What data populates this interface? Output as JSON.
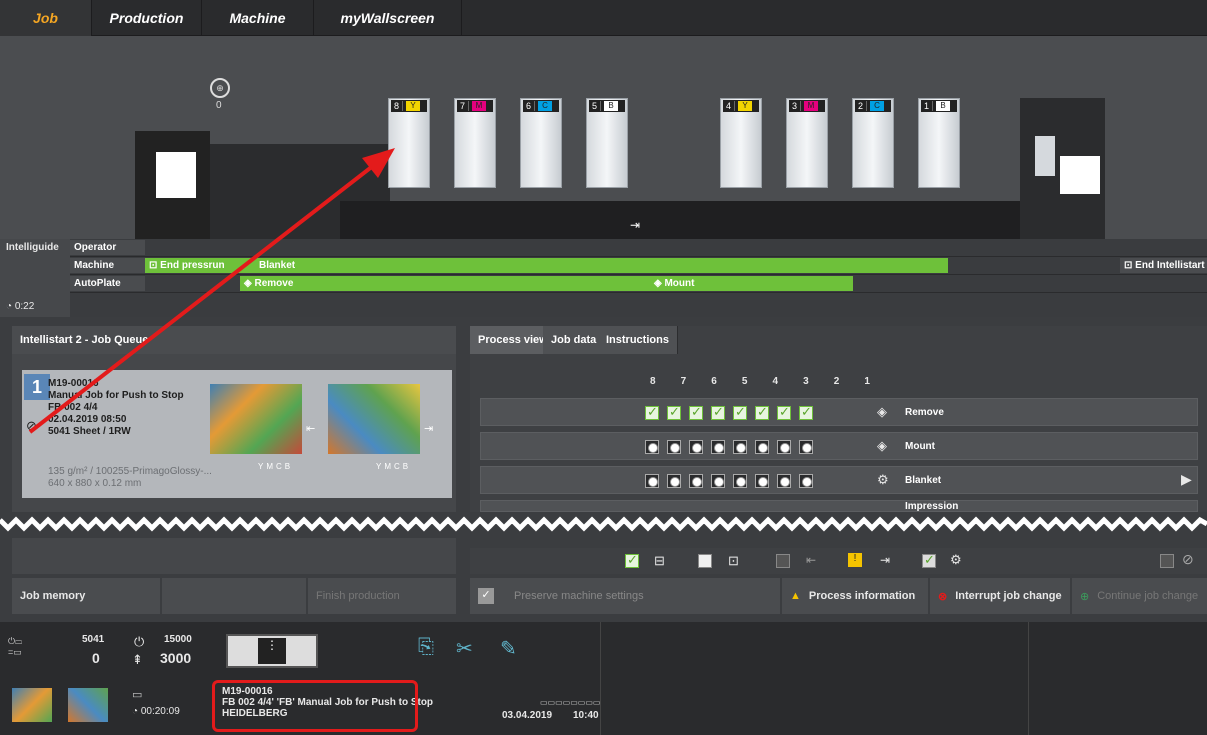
{
  "nav": {
    "tabs": [
      "Job",
      "Production",
      "Machine",
      "myWallscreen"
    ],
    "active": "Job"
  },
  "machine": {
    "counter_value": "0",
    "units": [
      {
        "num": "8",
        "color": "Y",
        "hex": "#f2d400"
      },
      {
        "num": "7",
        "color": "M",
        "hex": "#e5007e"
      },
      {
        "num": "6",
        "color": "C",
        "hex": "#00a0e3"
      },
      {
        "num": "5",
        "color": "B",
        "hex": "#ffffff"
      },
      {
        "num": "4",
        "color": "Y",
        "hex": "#f2d400"
      },
      {
        "num": "3",
        "color": "M",
        "hex": "#e5007e"
      },
      {
        "num": "2",
        "color": "C",
        "hex": "#00a0e3"
      },
      {
        "num": "1",
        "color": "B",
        "hex": "#ffffff"
      }
    ]
  },
  "intelliguide": {
    "title": "Intelliguide",
    "rows": [
      "Operator",
      "Machine",
      "AutoPlate"
    ],
    "end_pressrun": "End pressrun",
    "blanket": "Blanket",
    "remove": "Remove",
    "mount": "Mount",
    "end_intellistart": "End Intellistart",
    "time": "0:22"
  },
  "job_queue": {
    "title": "Intellistart 2 - Job Queue",
    "position": "1",
    "job_id": "M19-00016",
    "job_name": "Manual Job for Push to Stop",
    "form": "FB 002  4/4",
    "date": "02.04.2019 08:50",
    "sheets": "5041 Sheet / 1RW",
    "paper": "135 g/m² / 100255-PrimagoGlossy-...",
    "size": "640 x 880 x 0.12 mm",
    "inks": [
      "Y",
      "M",
      "C",
      "B"
    ]
  },
  "process_view": {
    "tabs": [
      "Process view",
      "Job data",
      "Instructions"
    ],
    "units": [
      "8",
      "7",
      "6",
      "5",
      "4",
      "3",
      "2",
      "1"
    ],
    "rows": [
      "Remove",
      "Mount",
      "Blanket",
      "Impression"
    ]
  },
  "bottom_bar": {
    "job_memory": "Job memory",
    "finish_production": "Finish production",
    "preserve": "Preserve machine settings",
    "process_info": "Process information",
    "interrupt": "Interrupt job change",
    "continue": "Continue job change"
  },
  "status": {
    "counter_top": "5041",
    "counter_bottom": "0",
    "speed_top": "15000",
    "speed_bottom": "3000",
    "timer": "00:20:09",
    "job_id": "M19-00016",
    "job_line": "FB 002  4/4' 'FB' Manual Job for Push to Stop",
    "company": "HEIDELBERG",
    "date": "03.04.2019",
    "time": "10:40"
  },
  "colors": {
    "accent": "#f5a623",
    "green": "#6ec13a",
    "red": "#e31b1b"
  }
}
